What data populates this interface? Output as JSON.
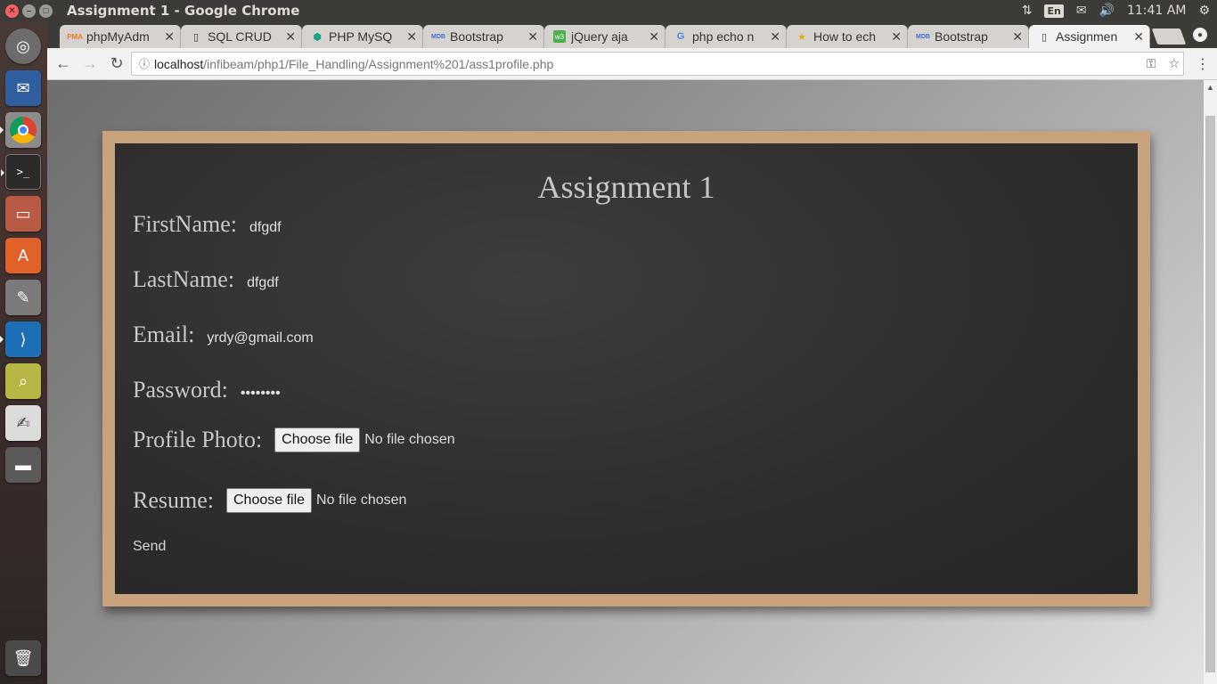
{
  "system": {
    "window_title": "Assignment 1 - Google Chrome",
    "lang": "En",
    "time": "11:41 AM"
  },
  "launcher": {
    "items": [
      {
        "name": "ubuntu-dash-icon"
      },
      {
        "name": "thunderbird-icon"
      },
      {
        "name": "chrome-icon"
      },
      {
        "name": "terminal-icon"
      },
      {
        "name": "file-manager-icon"
      },
      {
        "name": "software-center-icon"
      },
      {
        "name": "system-settings-icon"
      },
      {
        "name": "vscode-icon"
      },
      {
        "name": "system-monitor-icon"
      },
      {
        "name": "text-editor-icon"
      },
      {
        "name": "drive-icon"
      },
      {
        "name": "trash-icon"
      }
    ]
  },
  "tabs": [
    {
      "title": "phpMyAdm",
      "favicon": "pma-icon"
    },
    {
      "title": "SQL CRUD",
      "favicon": "document-icon"
    },
    {
      "title": "PHP MySQ",
      "favicon": "hex-icon"
    },
    {
      "title": "Bootstrap",
      "favicon": "mdb-icon"
    },
    {
      "title": "jQuery aja",
      "favicon": "w3-icon"
    },
    {
      "title": "php echo n",
      "favicon": "google-icon"
    },
    {
      "title": "How to ech",
      "favicon": "star-icon"
    },
    {
      "title": "Bootstrap",
      "favicon": "mdb-icon"
    },
    {
      "title": "Assignmen",
      "favicon": "document-icon"
    }
  ],
  "toolbar": {
    "url_host": "localhost",
    "url_path": "/infibeam/php1/File_Handling/Assignment%201/ass1profile.php"
  },
  "page": {
    "title": "Assignment 1",
    "fields": {
      "firstname_label": "FirstName:",
      "firstname_value": "dfgdf",
      "lastname_label": "LastName:",
      "lastname_value": "dfgdf",
      "email_label": "Email:",
      "email_value": "yrdy@gmail.com",
      "password_label": "Password:",
      "password_value": "••••••••",
      "photo_label": "Profile Photo:",
      "resume_label": "Resume:",
      "choose_file_label": "Choose file",
      "no_file_text": "No file chosen"
    },
    "send_label": "Send"
  }
}
